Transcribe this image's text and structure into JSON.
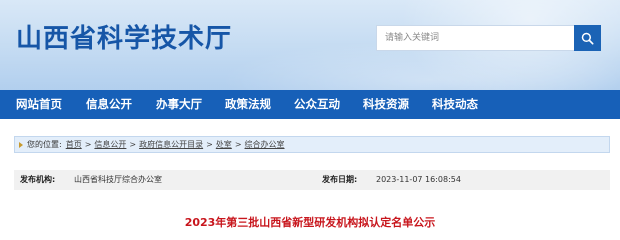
{
  "header": {
    "site_title": "山西省科学技术厅",
    "search": {
      "placeholder": "请输入关键词",
      "button_icon": "search-icon"
    }
  },
  "nav": {
    "items": [
      {
        "label": "网站首页"
      },
      {
        "label": "信息公开"
      },
      {
        "label": "办事大厅"
      },
      {
        "label": "政策法规"
      },
      {
        "label": "公众互动"
      },
      {
        "label": "科技资源"
      },
      {
        "label": "科技动态"
      }
    ]
  },
  "breadcrumb": {
    "prefix": "您的位置:",
    "items": [
      "首页",
      "信息公开",
      "政府信息公开目录",
      "处室",
      "综合办公室"
    ],
    "separator": ">"
  },
  "meta": {
    "publisher_label": "发布机构:",
    "publisher_value": "山西省科技厅综合办公室",
    "date_label": "发布日期:",
    "date_value": "2023-11-07 16:08:54"
  },
  "article": {
    "title": "2023年第三批山西省新型研发机构拟认定名单公示"
  },
  "colors": {
    "nav_bg": "#1760b8",
    "title_blue": "#1656a7",
    "article_title_red": "#c8161d",
    "search_button": "#1b63b5"
  }
}
